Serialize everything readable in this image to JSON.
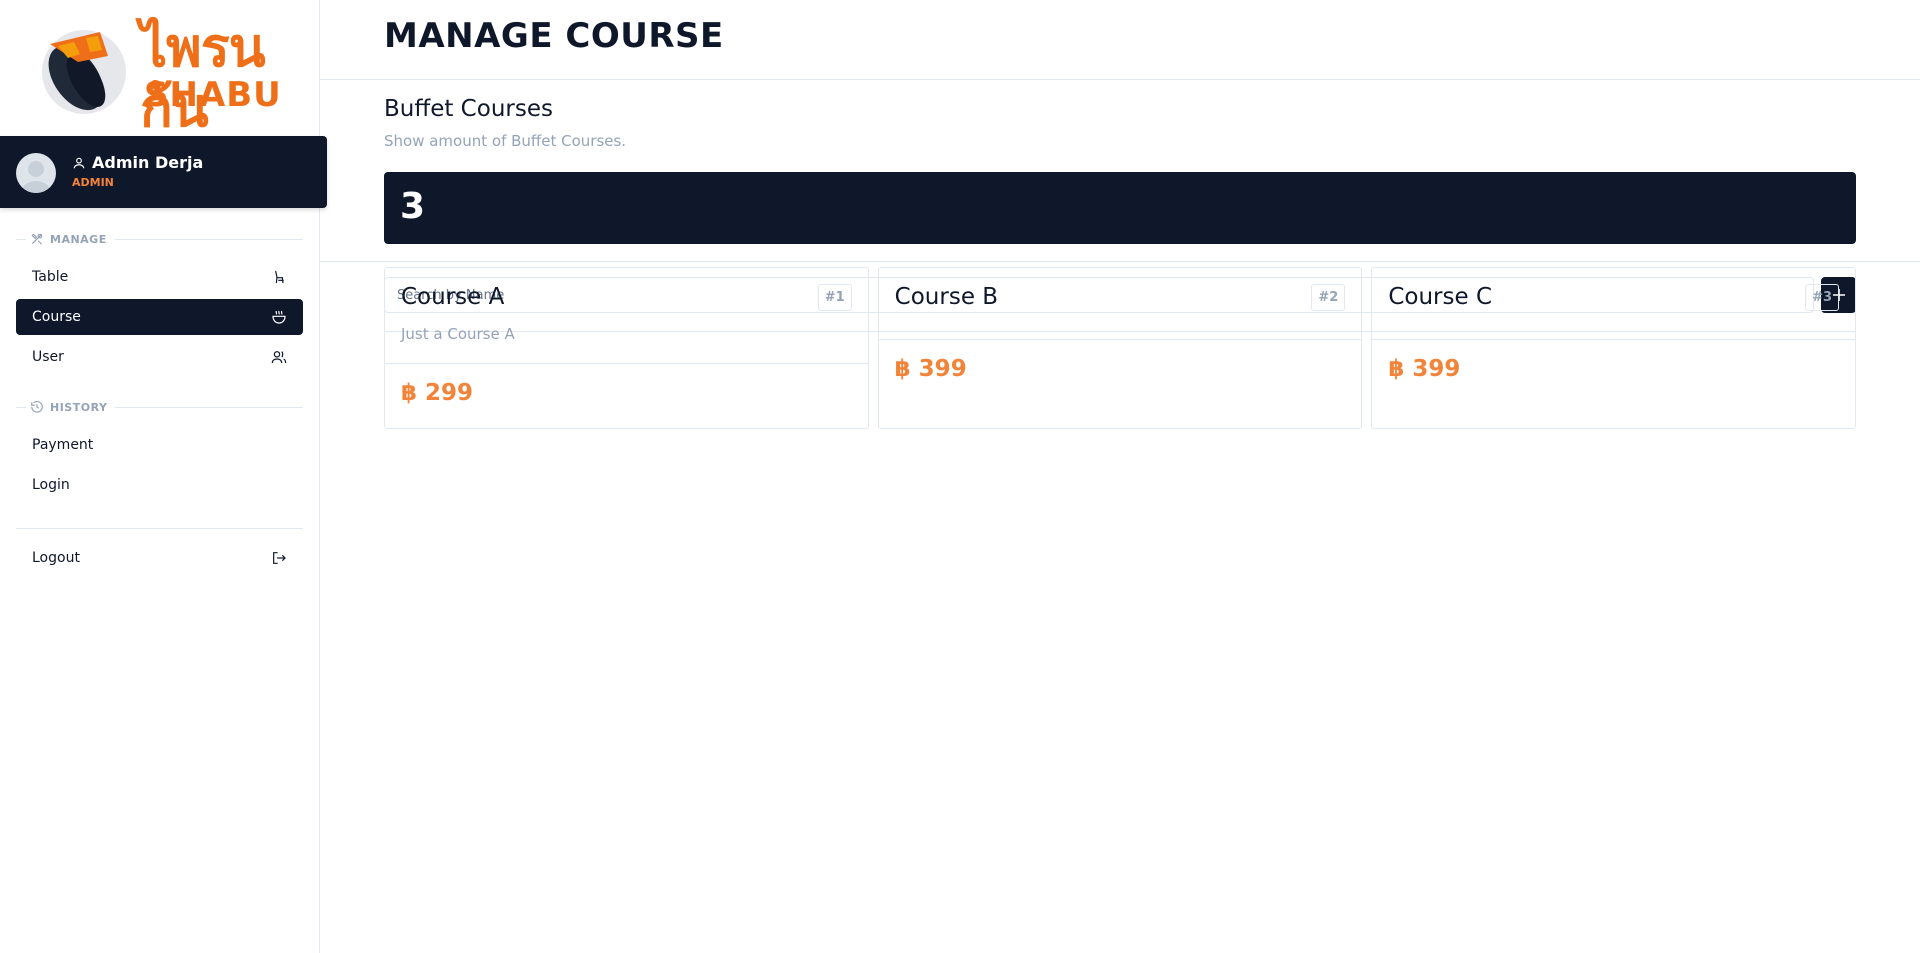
{
  "brand": {
    "logo_text": "ไพรนก้น",
    "logo_subtext": "SHABU"
  },
  "profile": {
    "name": "Admin Derja",
    "role": "ADMIN"
  },
  "sidebar": {
    "manage_label": "MANAGE",
    "history_label": "HISTORY",
    "items": [
      {
        "label": "Table",
        "icon": "table-chair-icon"
      },
      {
        "label": "Course",
        "icon": "hotpot-icon"
      },
      {
        "label": "User",
        "icon": "users-icon"
      }
    ],
    "history_items": [
      {
        "label": "Payment"
      },
      {
        "label": "Login"
      }
    ],
    "logout_label": "Logout"
  },
  "page": {
    "title": "MANAGE COURSE"
  },
  "stats": {
    "title": "Buffet Courses",
    "description": "Show amount of Buffet Courses.",
    "count": "3"
  },
  "search": {
    "placeholder": "Search by Name",
    "value": ""
  },
  "add_button": {
    "label": "+"
  },
  "courses": [
    {
      "name": "Course A",
      "description": "Just a Course A",
      "badge": "#1",
      "price": "฿ 299"
    },
    {
      "name": "Course B",
      "description": "",
      "badge": "#2",
      "price": "฿ 399"
    },
    {
      "name": "Course C",
      "description": "",
      "badge": "#3",
      "price": "฿ 399"
    }
  ],
  "colors": {
    "primary_dark": "#0f172a",
    "accent_orange": "#f2843a",
    "muted_text": "#94a3b8",
    "border": "#e2e8f0"
  }
}
